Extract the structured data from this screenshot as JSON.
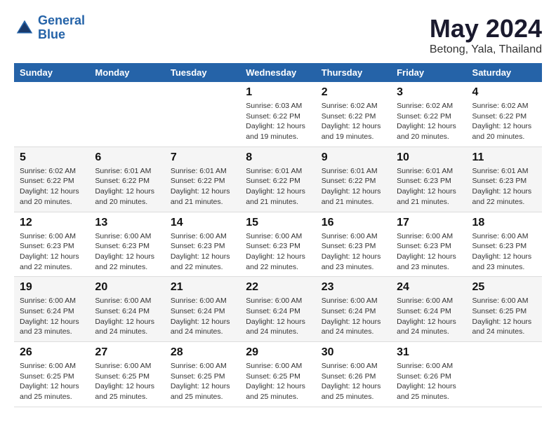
{
  "logo": {
    "line1": "General",
    "line2": "Blue"
  },
  "title": "May 2024",
  "subtitle": "Betong, Yala, Thailand",
  "days_of_week": [
    "Sunday",
    "Monday",
    "Tuesday",
    "Wednesday",
    "Thursday",
    "Friday",
    "Saturday"
  ],
  "weeks": [
    [
      {
        "day": "",
        "info": ""
      },
      {
        "day": "",
        "info": ""
      },
      {
        "day": "",
        "info": ""
      },
      {
        "day": "1",
        "info": "Sunrise: 6:03 AM\nSunset: 6:22 PM\nDaylight: 12 hours\nand 19 minutes."
      },
      {
        "day": "2",
        "info": "Sunrise: 6:02 AM\nSunset: 6:22 PM\nDaylight: 12 hours\nand 19 minutes."
      },
      {
        "day": "3",
        "info": "Sunrise: 6:02 AM\nSunset: 6:22 PM\nDaylight: 12 hours\nand 20 minutes."
      },
      {
        "day": "4",
        "info": "Sunrise: 6:02 AM\nSunset: 6:22 PM\nDaylight: 12 hours\nand 20 minutes."
      }
    ],
    [
      {
        "day": "5",
        "info": "Sunrise: 6:02 AM\nSunset: 6:22 PM\nDaylight: 12 hours\nand 20 minutes."
      },
      {
        "day": "6",
        "info": "Sunrise: 6:01 AM\nSunset: 6:22 PM\nDaylight: 12 hours\nand 20 minutes."
      },
      {
        "day": "7",
        "info": "Sunrise: 6:01 AM\nSunset: 6:22 PM\nDaylight: 12 hours\nand 21 minutes."
      },
      {
        "day": "8",
        "info": "Sunrise: 6:01 AM\nSunset: 6:22 PM\nDaylight: 12 hours\nand 21 minutes."
      },
      {
        "day": "9",
        "info": "Sunrise: 6:01 AM\nSunset: 6:22 PM\nDaylight: 12 hours\nand 21 minutes."
      },
      {
        "day": "10",
        "info": "Sunrise: 6:01 AM\nSunset: 6:23 PM\nDaylight: 12 hours\nand 21 minutes."
      },
      {
        "day": "11",
        "info": "Sunrise: 6:01 AM\nSunset: 6:23 PM\nDaylight: 12 hours\nand 22 minutes."
      }
    ],
    [
      {
        "day": "12",
        "info": "Sunrise: 6:00 AM\nSunset: 6:23 PM\nDaylight: 12 hours\nand 22 minutes."
      },
      {
        "day": "13",
        "info": "Sunrise: 6:00 AM\nSunset: 6:23 PM\nDaylight: 12 hours\nand 22 minutes."
      },
      {
        "day": "14",
        "info": "Sunrise: 6:00 AM\nSunset: 6:23 PM\nDaylight: 12 hours\nand 22 minutes."
      },
      {
        "day": "15",
        "info": "Sunrise: 6:00 AM\nSunset: 6:23 PM\nDaylight: 12 hours\nand 22 minutes."
      },
      {
        "day": "16",
        "info": "Sunrise: 6:00 AM\nSunset: 6:23 PM\nDaylight: 12 hours\nand 23 minutes."
      },
      {
        "day": "17",
        "info": "Sunrise: 6:00 AM\nSunset: 6:23 PM\nDaylight: 12 hours\nand 23 minutes."
      },
      {
        "day": "18",
        "info": "Sunrise: 6:00 AM\nSunset: 6:23 PM\nDaylight: 12 hours\nand 23 minutes."
      }
    ],
    [
      {
        "day": "19",
        "info": "Sunrise: 6:00 AM\nSunset: 6:24 PM\nDaylight: 12 hours\nand 23 minutes."
      },
      {
        "day": "20",
        "info": "Sunrise: 6:00 AM\nSunset: 6:24 PM\nDaylight: 12 hours\nand 24 minutes."
      },
      {
        "day": "21",
        "info": "Sunrise: 6:00 AM\nSunset: 6:24 PM\nDaylight: 12 hours\nand 24 minutes."
      },
      {
        "day": "22",
        "info": "Sunrise: 6:00 AM\nSunset: 6:24 PM\nDaylight: 12 hours\nand 24 minutes."
      },
      {
        "day": "23",
        "info": "Sunrise: 6:00 AM\nSunset: 6:24 PM\nDaylight: 12 hours\nand 24 minutes."
      },
      {
        "day": "24",
        "info": "Sunrise: 6:00 AM\nSunset: 6:24 PM\nDaylight: 12 hours\nand 24 minutes."
      },
      {
        "day": "25",
        "info": "Sunrise: 6:00 AM\nSunset: 6:25 PM\nDaylight: 12 hours\nand 24 minutes."
      }
    ],
    [
      {
        "day": "26",
        "info": "Sunrise: 6:00 AM\nSunset: 6:25 PM\nDaylight: 12 hours\nand 25 minutes."
      },
      {
        "day": "27",
        "info": "Sunrise: 6:00 AM\nSunset: 6:25 PM\nDaylight: 12 hours\nand 25 minutes."
      },
      {
        "day": "28",
        "info": "Sunrise: 6:00 AM\nSunset: 6:25 PM\nDaylight: 12 hours\nand 25 minutes."
      },
      {
        "day": "29",
        "info": "Sunrise: 6:00 AM\nSunset: 6:25 PM\nDaylight: 12 hours\nand 25 minutes."
      },
      {
        "day": "30",
        "info": "Sunrise: 6:00 AM\nSunset: 6:26 PM\nDaylight: 12 hours\nand 25 minutes."
      },
      {
        "day": "31",
        "info": "Sunrise: 6:00 AM\nSunset: 6:26 PM\nDaylight: 12 hours\nand 25 minutes."
      },
      {
        "day": "",
        "info": ""
      }
    ]
  ]
}
